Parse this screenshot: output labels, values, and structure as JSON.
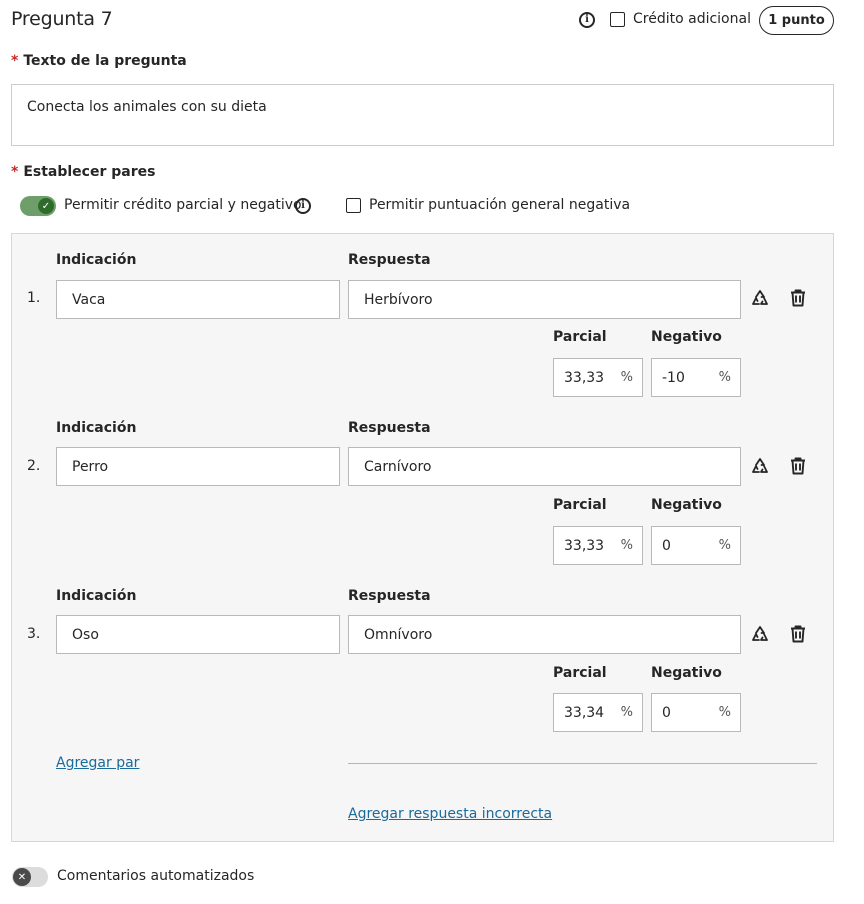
{
  "header": {
    "title": "Pregunta 7",
    "extra_credit_label": "Crédito adicional",
    "points_label": "1 punto"
  },
  "question": {
    "label": "Texto de la pregunta",
    "required_marker": "*",
    "text": "Conecta los animales con su dieta"
  },
  "pairs_section": {
    "label": "Establecer pares",
    "required_marker": "*",
    "partial_credit_label": "Permitir crédito parcial y negativo",
    "partial_credit_enabled": true,
    "negative_score_label": "Permitir puntuación general negativa",
    "negative_score_checked": false,
    "prompt_header": "Indicación",
    "answer_header": "Respuesta",
    "partial_header": "Parcial",
    "negative_header": "Negativo",
    "percent_symbol": "%",
    "pairs": [
      {
        "number": "1.",
        "prompt": "Vaca",
        "answer": "Herbívoro",
        "partial": "33,33",
        "negative": "-10"
      },
      {
        "number": "2.",
        "prompt": "Perro",
        "answer": "Carnívoro",
        "partial": "33,33",
        "negative": "0"
      },
      {
        "number": "3.",
        "prompt": "Oso",
        "answer": "Omnívoro",
        "partial": "33,34",
        "negative": "0"
      }
    ],
    "add_pair_label": "Agregar par",
    "add_wrong_answer_label": "Agregar respuesta incorrecta"
  },
  "feedback": {
    "label": "Comentarios automatizados",
    "enabled": false
  },
  "icons": {
    "info": "info-icon",
    "shuffle": "recycle-icon",
    "delete": "trash-icon"
  },
  "colors": {
    "toggle_on": "#2f6b2a",
    "link": "#1a6a9a",
    "required": "#c62828"
  }
}
